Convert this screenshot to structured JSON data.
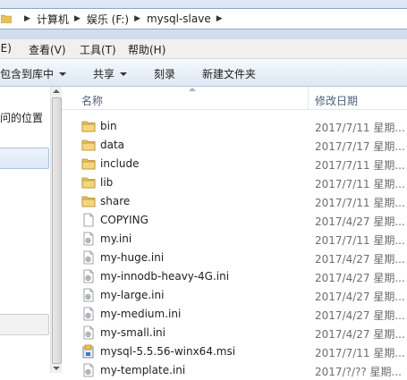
{
  "address": {
    "crumbs": [
      "计算机",
      "娱乐 (F:)",
      "mysql-slave"
    ]
  },
  "menu": {
    "edit": "(E)",
    "view": "查看(V)",
    "tools": "工具(T)",
    "help": "帮助(H)"
  },
  "commands": {
    "include_in_library": "包含到库中",
    "share": "共享",
    "burn": "刻录",
    "new_folder": "新建文件夹"
  },
  "nav": {
    "recent_places_partial": "问的位置"
  },
  "columns": {
    "name": "名称",
    "modified": "修改日期"
  },
  "files": [
    {
      "name": "bin",
      "date": "2017/7/11 星期...",
      "icon": "folder-icon"
    },
    {
      "name": "data",
      "date": "2017/7/17 星期...",
      "icon": "folder-icon"
    },
    {
      "name": "include",
      "date": "2017/7/11 星期...",
      "icon": "folder-icon"
    },
    {
      "name": "lib",
      "date": "2017/7/11 星期...",
      "icon": "folder-icon"
    },
    {
      "name": "share",
      "date": "2017/7/11 星期...",
      "icon": "folder-icon"
    },
    {
      "name": "COPYING",
      "date": "2017/4/27 星期...",
      "icon": "file-icon"
    },
    {
      "name": "my.ini",
      "date": "2017/7/11 星期...",
      "icon": "ini-file-icon"
    },
    {
      "name": "my-huge.ini",
      "date": "2017/4/27 星期...",
      "icon": "ini-file-icon"
    },
    {
      "name": "my-innodb-heavy-4G.ini",
      "date": "2017/4/27 星期...",
      "icon": "ini-file-icon"
    },
    {
      "name": "my-large.ini",
      "date": "2017/4/27 星期...",
      "icon": "ini-file-icon"
    },
    {
      "name": "my-medium.ini",
      "date": "2017/4/27 星期...",
      "icon": "ini-file-icon"
    },
    {
      "name": "my-small.ini",
      "date": "2017/4/27 星期...",
      "icon": "ini-file-icon"
    },
    {
      "name": "mysql-5.5.56-winx64.msi",
      "date": "2017/7/11 星期...",
      "icon": "msi-installer-icon"
    },
    {
      "name": "my-template.ini",
      "date": "2017/?/?? 星期...",
      "icon": "ini-file-icon"
    }
  ]
}
